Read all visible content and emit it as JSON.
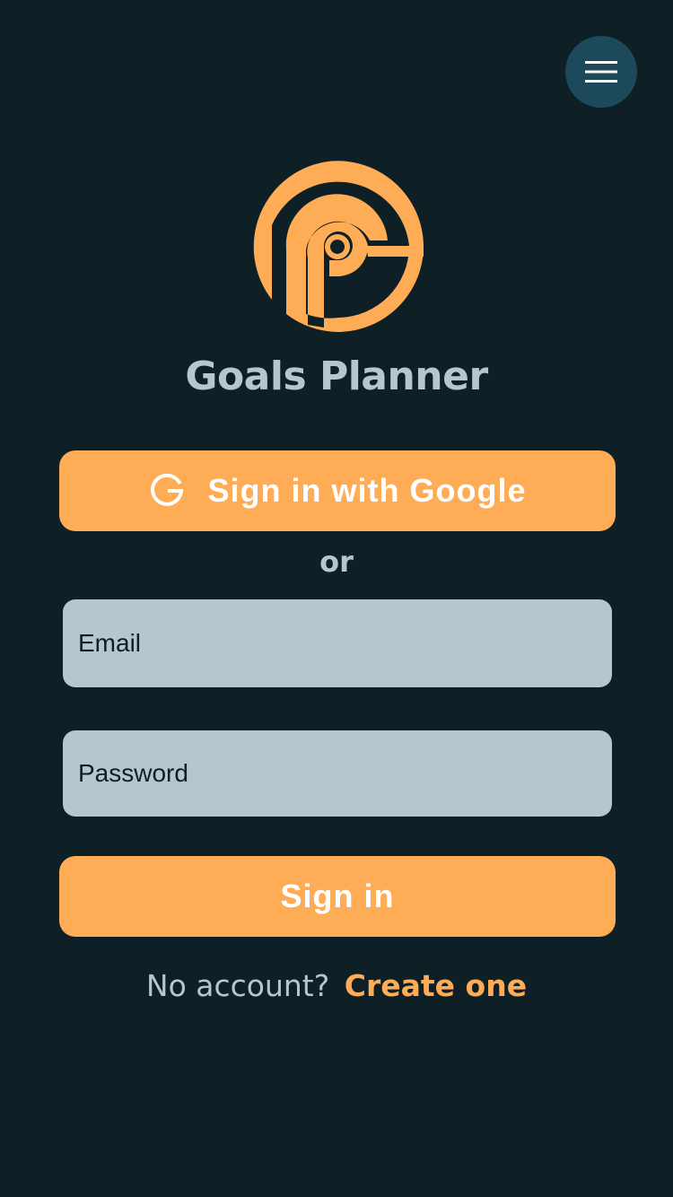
{
  "app": {
    "title": "Goals Planner",
    "logo_icon": "goals-planner-logo-icon",
    "menu_icon": "hamburger-menu-icon"
  },
  "colors": {
    "background": "#0e1f26",
    "accent": "#ffac56",
    "field_background": "#b3c7cd",
    "menu_button": "#1d4a5a",
    "muted_text": "#b3c7cd"
  },
  "auth": {
    "google_button_label": "Sign in with Google",
    "google_icon": "google-g-icon",
    "separator": "or",
    "email_placeholder": "Email",
    "email_value": "",
    "password_placeholder": "Password",
    "password_value": "",
    "signin_label": "Sign in",
    "no_account_text": "No account?",
    "create_account_link": "Create one"
  }
}
